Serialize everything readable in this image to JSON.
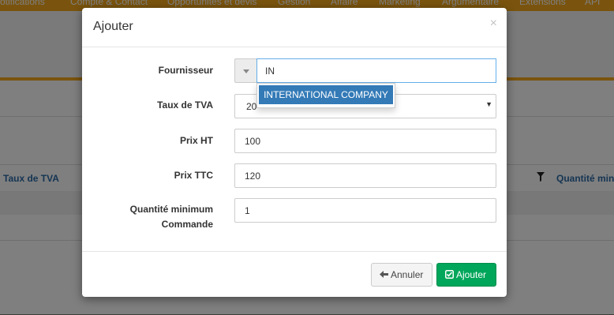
{
  "background": {
    "nav_items": [
      "otifications",
      "Compte & Contact",
      "Opportunités et devis",
      "Gestion",
      "Affaire",
      "Marketing",
      "Argumentaire",
      "Extensions",
      "API"
    ],
    "table_header_left": "Taux de TVA",
    "table_header_right": "Quantité minim",
    "accent_color": "#f4a81d"
  },
  "modal": {
    "title": "Ajouter",
    "close_label": "×",
    "fields": {
      "fournisseur": {
        "label": "Fournisseur",
        "value": "IN"
      },
      "taux_tva": {
        "label": "Taux de TVA",
        "value": "20"
      },
      "prix_ht": {
        "label": "Prix HT",
        "value": "100"
      },
      "prix_ttc": {
        "label": "Prix TTC",
        "value": "120"
      },
      "quantite": {
        "label_line1": "Quantité minimum",
        "label_line2": "Commande",
        "value": "1"
      }
    },
    "suggestion": "INTERNATIONAL COMPANY",
    "buttons": {
      "cancel": {
        "icon": "arrow-left-icon",
        "label": "Annuler"
      },
      "add": {
        "icon": "check-square-icon",
        "label": "Ajouter",
        "color": "#00a65a"
      }
    }
  }
}
